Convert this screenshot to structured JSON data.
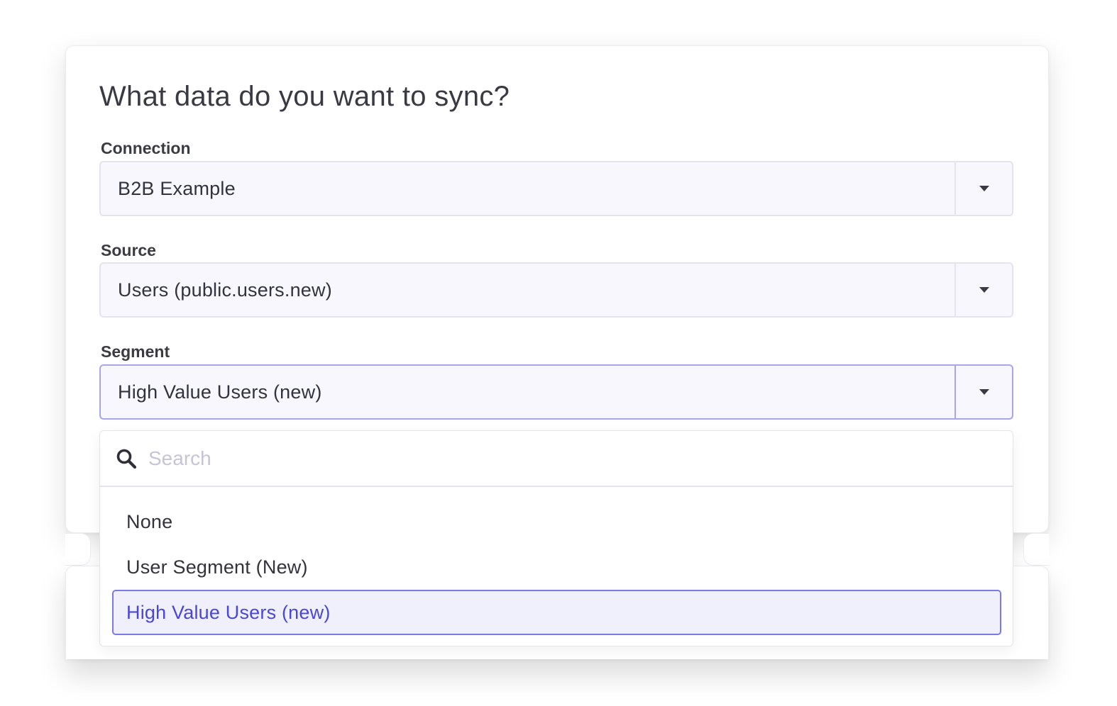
{
  "form": {
    "heading": "What data do you want to sync?",
    "connection": {
      "label": "Connection",
      "value": "B2B Example"
    },
    "source": {
      "label": "Source",
      "value": "Users (public.users.new)"
    },
    "segment": {
      "label": "Segment",
      "value": "High Value Users (new)"
    }
  },
  "dropdown": {
    "search_placeholder": "Search",
    "options": [
      {
        "label": "None",
        "selected": false
      },
      {
        "label": "User Segment (New)",
        "selected": false
      },
      {
        "label": "High Value Users (new)",
        "selected": true
      }
    ]
  },
  "icons": {
    "caret": "chevron-down-icon",
    "search": "search-icon"
  },
  "colors": {
    "accent": "#4a47d6",
    "focus_border": "#a8a6ea",
    "field_bg": "#f7f7fd",
    "selected_bg": "#f0f0fd"
  }
}
